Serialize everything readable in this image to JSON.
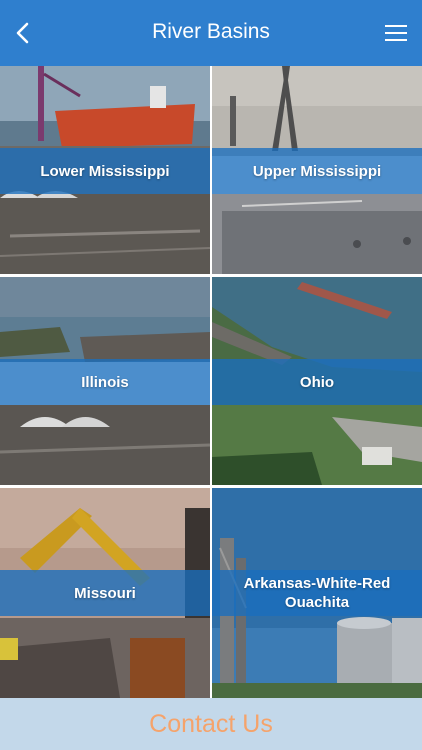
{
  "header": {
    "title": "River Basins",
    "back_icon": "chevron-left-icon",
    "menu_icon": "hamburger-menu-icon"
  },
  "basins": [
    {
      "label": "Lower Mississippi"
    },
    {
      "label": "Upper Mississippi"
    },
    {
      "label": "Illinois"
    },
    {
      "label": "Ohio"
    },
    {
      "label": "Missouri"
    },
    {
      "label": "Arkansas-White-Red Ouachita"
    }
  ],
  "footer": {
    "contact_label": "Contact Us"
  },
  "colors": {
    "header_bg": "#2f7fce",
    "band_bg": "#1a6ebe",
    "footer_bg": "#c3d8ea",
    "contact_text": "#f5a36b"
  }
}
